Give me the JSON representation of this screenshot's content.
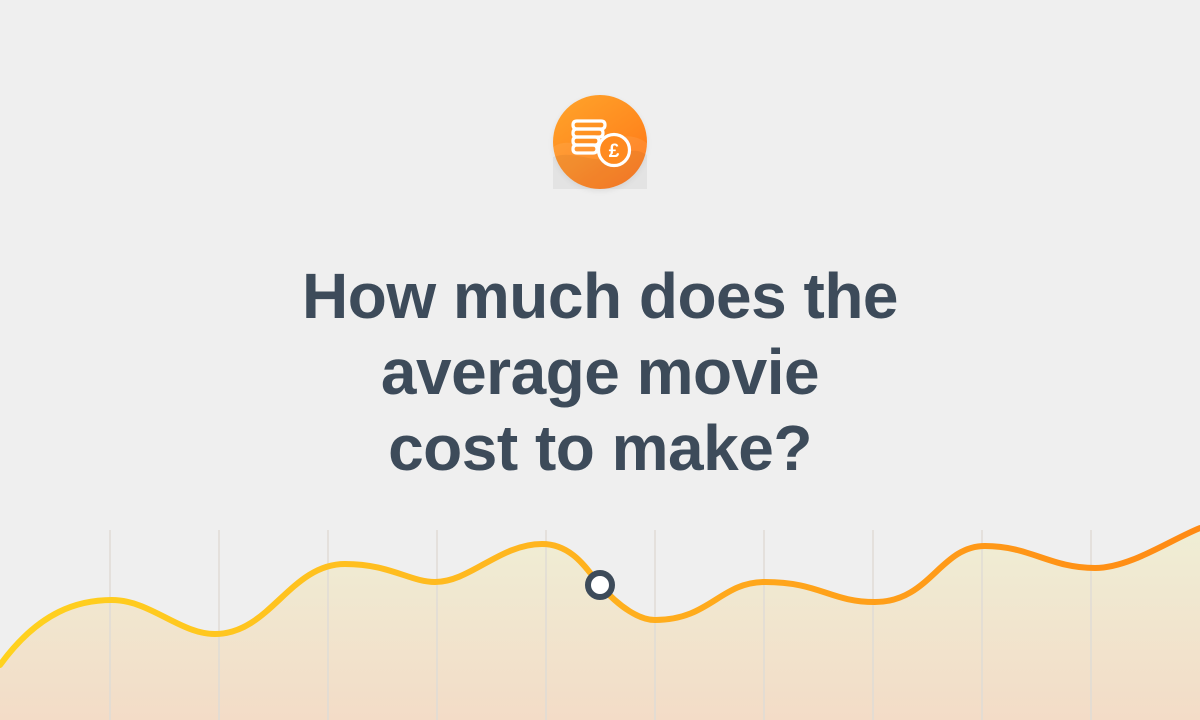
{
  "logo": {
    "icon": "coin-stack-pound-icon",
    "colors": [
      "#ffa52b",
      "#ff6f14"
    ]
  },
  "headline": {
    "lines": [
      "How much does the",
      "average movie",
      "cost to make?"
    ]
  },
  "decoration": {
    "gridline_color": "#e0dcd5",
    "line_gradient": [
      "#ffd21f",
      "#ffb51f",
      "#ff8a14"
    ],
    "fill_gradient": [
      "#efeed5",
      "#f3dcc7"
    ],
    "marker_ring_color": "#3d4b5a"
  }
}
